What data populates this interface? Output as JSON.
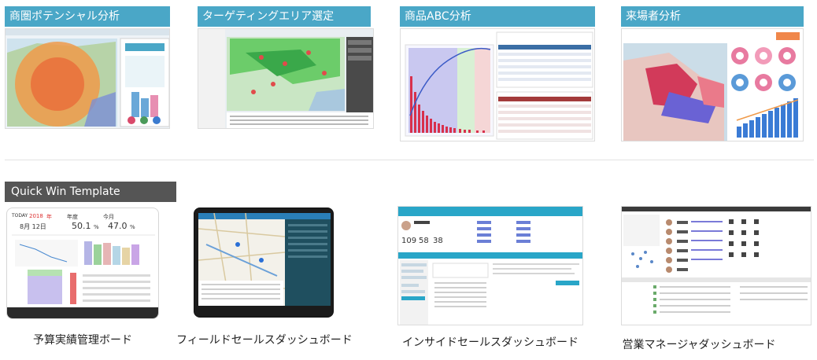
{
  "sections": {
    "top": [
      {
        "label": "商圏ポテンシャル分析",
        "thumb_icon": "heatmap-map-icon"
      },
      {
        "label": "ターゲティングエリア選定",
        "thumb_icon": "area-map-icon"
      },
      {
        "label": "商品ABC分析",
        "thumb_icon": "pareto-chart-icon"
      },
      {
        "label": "来場者分析",
        "thumb_icon": "visitor-map-icon"
      }
    ],
    "quick_win": {
      "label": "Quick Win Template",
      "items": [
        {
          "caption": "予算実績管理ボード",
          "screen": {
            "date_label": "TODAY",
            "year": "2018",
            "year_unit": "年",
            "date": "8月 12日",
            "kpi1_label": "年度",
            "kpi1_value": "50.1",
            "kpi1_unit": "%",
            "kpi2_label": "今月",
            "kpi2_value": "47.0",
            "kpi2_unit": "%"
          }
        },
        {
          "caption": "フィールドセールスダッシュボード"
        },
        {
          "caption": "インサイドセールスダッシュボード",
          "screen": {
            "n1": "109",
            "n2": "58",
            "n3": "38"
          }
        },
        {
          "caption": "営業マネージャダッシュボード"
        }
      ]
    }
  },
  "colors": {
    "label_teal": "#4aa7c7",
    "label_dark": "#555555"
  }
}
